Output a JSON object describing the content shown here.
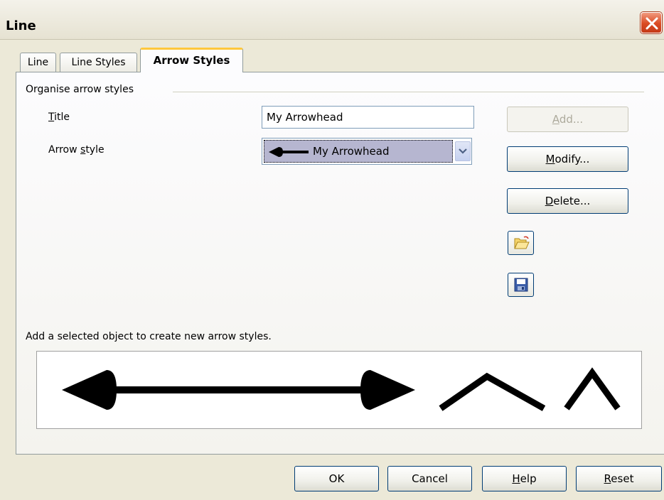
{
  "window": {
    "title": "Line"
  },
  "tabs": [
    {
      "label": "Line"
    },
    {
      "label": "Line Styles"
    },
    {
      "label": "Arrow Styles"
    }
  ],
  "organise": {
    "group_label": "Organise arrow styles",
    "title_label_mnemonic": "T",
    "title_label_rest": "itle",
    "title_value": "My Arrowhead",
    "style_label_prefix": "Arrow ",
    "style_label_mnemonic": "s",
    "style_label_suffix": "tyle",
    "style_value": "My Arrowhead"
  },
  "buttons": {
    "add": {
      "mnemonic": "A",
      "rest": "dd..."
    },
    "modify": {
      "mnemonic": "M",
      "rest": "odify..."
    },
    "delete": {
      "mnemonic": "D",
      "rest": "elete..."
    },
    "load_icon": "folder-open-icon",
    "save_icon": "floppy-disk-icon"
  },
  "hint": "Add a selected object to create new arrow styles.",
  "footer": {
    "ok": "OK",
    "cancel": "Cancel",
    "help_mnemonic": "H",
    "help_rest": "elp",
    "reset_mnemonic": "R",
    "reset_rest": "eset"
  },
  "colors": {
    "dialog_bg": "#ECE9D8",
    "close_button": "#DA4A22",
    "active_tab_accent": "#FFC83C",
    "selected_item_bg": "#B6B6D0"
  }
}
